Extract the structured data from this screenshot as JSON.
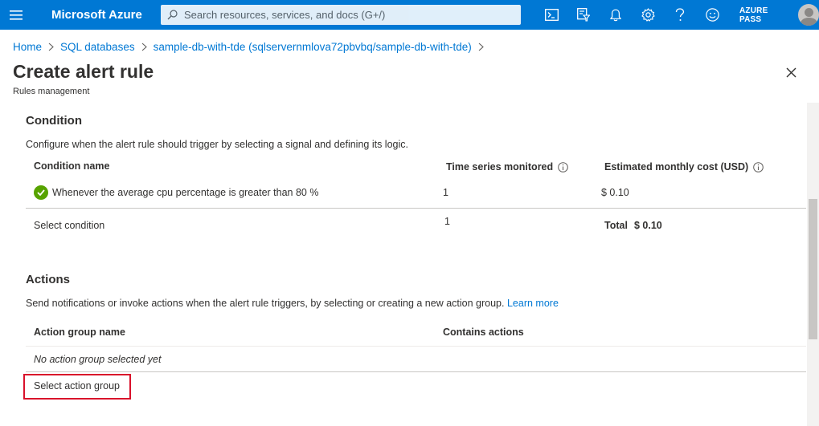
{
  "topbar": {
    "brand": "Microsoft Azure",
    "search_placeholder": "Search resources, services, and docs (G+/)",
    "account_label": "AZURE PASS",
    "icons": [
      "menu-icon",
      "cloud-shell-icon",
      "directory-filter-icon",
      "notifications-icon",
      "settings-icon",
      "help-icon",
      "feedback-icon"
    ]
  },
  "breadcrumb": {
    "items": [
      "Home",
      "SQL databases",
      "sample-db-with-tde (sqlservernmlova72pbvbq/sample-db-with-tde)"
    ]
  },
  "page": {
    "title": "Create alert rule",
    "subtitle": "Rules management"
  },
  "condition": {
    "title": "Condition",
    "description": "Configure when the alert rule should trigger by selecting a signal and defining its logic.",
    "columns": {
      "name": "Condition name",
      "time_series": "Time series monitored",
      "cost": "Estimated monthly cost (USD)"
    },
    "row": {
      "name": "Whenever the average cpu percentage is greater than 80 %",
      "time_series": "1",
      "cost": "$ 0.10"
    },
    "select_link": "Select condition",
    "total_series": "1",
    "total_label": "Total",
    "total_value": "$ 0.10"
  },
  "actions": {
    "title": "Actions",
    "description": "Send notifications or invoke actions when the alert rule triggers, by selecting or creating a new action group.",
    "learn_more": "Learn more",
    "columns": {
      "name": "Action group name",
      "contains": "Contains actions"
    },
    "empty_text": "No action group selected yet",
    "select_link": "Select action group"
  },
  "colors": {
    "accent": "#0078d4",
    "success": "#57a300",
    "highlight": "#d9112b"
  }
}
